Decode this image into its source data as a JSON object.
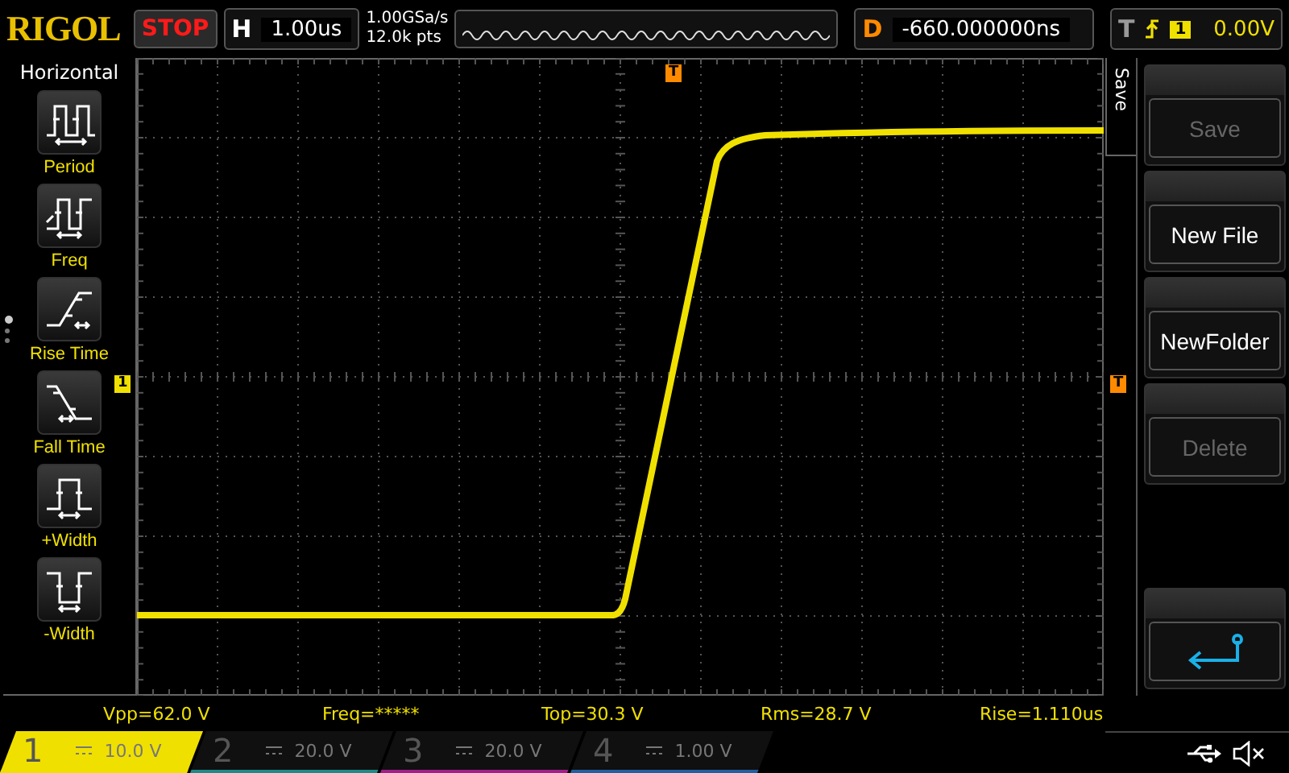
{
  "top_bar": {
    "logo": "RIGOL",
    "run_state": "STOP",
    "timebase": {
      "label": "H",
      "value": "1.00us"
    },
    "sampling": {
      "rate": "1.00GSa/s",
      "points": "12.0k pts"
    },
    "delay": {
      "label": "D",
      "value": "-660.000000ns"
    },
    "trigger": {
      "label": "T",
      "source": "1",
      "level": "0.00V"
    }
  },
  "sidebar": {
    "title": "Horizontal",
    "pages": [
      {
        "selected": true
      },
      {
        "selected": false
      },
      {
        "selected": false
      }
    ],
    "items": [
      {
        "label": "Period",
        "kind": "period"
      },
      {
        "label": "Freq",
        "kind": "freq"
      },
      {
        "label": "Rise Time",
        "kind": "rise"
      },
      {
        "label": "Fall Time",
        "kind": "fall"
      },
      {
        "label": "+Width",
        "kind": "pwidth"
      },
      {
        "label": "-Width",
        "kind": "nwidth"
      }
    ]
  },
  "screen": {
    "trigger_position_marker": "T",
    "channel_marker": "1",
    "trigger_level_marker": "T"
  },
  "menu": {
    "title": "Save",
    "buttons": [
      {
        "kind": "text",
        "label": "Save",
        "disabled": true
      },
      {
        "kind": "text",
        "label": "New File",
        "disabled": false
      },
      {
        "kind": "text",
        "label": "NewFolder",
        "disabled": false
      },
      {
        "kind": "text",
        "label": "Delete",
        "disabled": true
      },
      {
        "kind": "back"
      }
    ]
  },
  "measurements": [
    "Vpp=62.0 V",
    "Freq=*****",
    "Top=30.3 V",
    "Rms=28.7 V",
    "Rise=1.110us"
  ],
  "channels": [
    {
      "number": "1",
      "reading": "10.0 V",
      "active": true,
      "color": "#f0e000"
    },
    {
      "number": "2",
      "reading": "20.0 V",
      "active": false,
      "color": "#1e8a88"
    },
    {
      "number": "3",
      "reading": "20.0 V",
      "active": false,
      "color": "#a0208a"
    },
    {
      "number": "4",
      "reading": "1.00 V",
      "active": false,
      "color": "#2060a0"
    }
  ]
}
